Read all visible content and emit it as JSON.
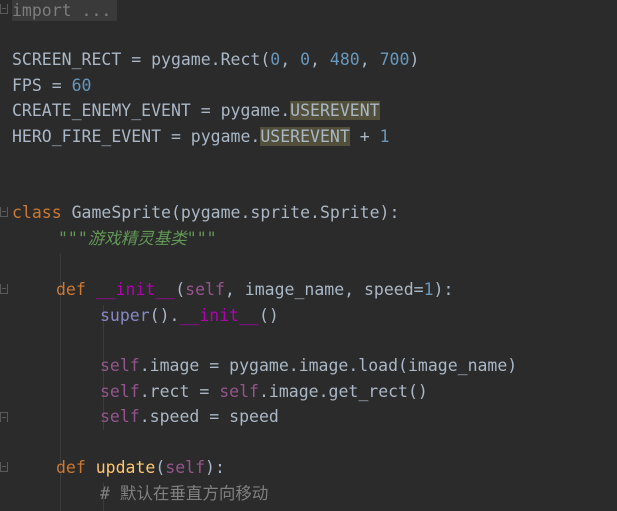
{
  "code": {
    "fold_placeholder": "import ...",
    "l_rect": {
      "name": "SCREEN_RECT = pygame.Rect(",
      "a": "0",
      "b": "0",
      "c": "480",
      "d": "700",
      "sep": ", ",
      "close": ")"
    },
    "l_fps": {
      "name": "FPS = ",
      "val": "60"
    },
    "l_enemy": {
      "prefix": "CREATE_ENEMY_EVENT = pygame.",
      "hl": "USEREVENT"
    },
    "l_hero": {
      "prefix": "HERO_FIRE_EVENT = pygame.",
      "hl": "USEREVENT",
      "op": " + ",
      "val": "1"
    },
    "l_class": {
      "kw": "class",
      "rest": " GameSprite(pygame.sprite.Sprite):"
    },
    "l_doc": "\"\"\"游戏精灵基类\"\"\"",
    "l_def_init": {
      "kw": "def",
      "name": "__init__",
      "open": "(",
      "self": "self",
      "rest": ", image_name, speed=",
      "val": "1",
      "close": "):"
    },
    "l_super": {
      "fn": "super",
      "mid": "().",
      "magic": "__init__",
      "close": "()"
    },
    "l_image": {
      "self": "self",
      "rest": ".image = pygame.image.load(image_name)"
    },
    "l_rect2": {
      "self": "self",
      "mid": ".rect = ",
      "self2": "self",
      "rest": ".image.get_rect()"
    },
    "l_speed": {
      "self": "self",
      "rest": ".speed = speed"
    },
    "l_def_update": {
      "kw": "def",
      "name": "update",
      "open": "(",
      "self": "self",
      "close": "):"
    },
    "l_comment": "# 默认在垂直方向移动"
  },
  "colors": {
    "background": "#2b2b2b",
    "keyword": "#cc7832",
    "number": "#6897bb",
    "function": "#ffc66d",
    "magic_method": "#b200b2",
    "self": "#94558d",
    "docstring": "#629755",
    "comment": "#808080",
    "highlight": "#52503a"
  }
}
